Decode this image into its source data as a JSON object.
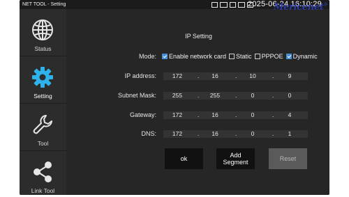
{
  "statusbar": {
    "app_title": "NET TOOL - Setting",
    "time": "2025-06-24 16:10:29",
    "icons": [
      "sd-card-icon",
      "battery-icon",
      "usb-icon",
      "hdmi-icon",
      "lock-icon"
    ]
  },
  "watermark": {
    "text": "Mericenet",
    "mark": "®"
  },
  "sidebar": {
    "items": [
      {
        "label": "Status",
        "icon": "globe-icon"
      },
      {
        "label": "Setting",
        "icon": "gear-icon"
      },
      {
        "label": "Tool",
        "icon": "wrench-icon"
      },
      {
        "label": "Link Tool",
        "icon": "share-icon"
      }
    ],
    "active": "Setting",
    "colors": {
      "active_icon": "#2fb2ec",
      "icon": "#e6e6e6"
    }
  },
  "ip_setting": {
    "title": "IP Setting",
    "mode": {
      "label": "Mode:",
      "options": [
        {
          "label": "Enable network card",
          "checked": true
        },
        {
          "label": "Static",
          "checked": false
        },
        {
          "label": "PPPOE",
          "checked": false
        },
        {
          "label": "Dynamic",
          "checked": true
        }
      ]
    },
    "fields": [
      {
        "label": "IP address:",
        "octets": [
          "172",
          "16",
          "10",
          "9"
        ]
      },
      {
        "label": "Subnet Mask:",
        "octets": [
          "255",
          "255",
          "0",
          "0"
        ]
      },
      {
        "label": "Gateway:",
        "octets": [
          "172",
          "16",
          "0",
          "4"
        ]
      },
      {
        "label": "DNS:",
        "octets": [
          "172",
          "16",
          "0",
          "1"
        ]
      }
    ],
    "separator": ".",
    "buttons": {
      "ok": "ok",
      "add_segment_line1": "Add",
      "add_segment_line2": "Segment",
      "reset": "Reset"
    }
  }
}
